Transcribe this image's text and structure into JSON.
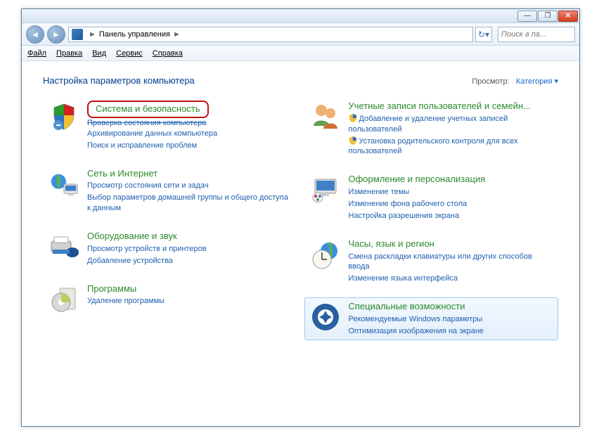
{
  "window": {
    "min": "—",
    "max": "❐",
    "close": "✕"
  },
  "nav": {
    "back": "◄",
    "fwd": "►",
    "crumb": "Панель управления",
    "arrow": "►",
    "refresh": "↻▾"
  },
  "search": {
    "placeholder": "Поиск в па..."
  },
  "menu": {
    "file": "Файл",
    "edit": "Правка",
    "view": "Вид",
    "tools": "Сервис",
    "help": "Справка"
  },
  "heading": "Настройка параметров компьютера",
  "view_label": "Просмотр:",
  "view_value": "Категория ▾",
  "left": [
    {
      "title": "Система и безопасность",
      "highlighted": true,
      "strike": "Проверка состояния компьютера",
      "subs": [
        "Архивирование данных компьютера",
        "Поиск и исправление проблем"
      ]
    },
    {
      "title": "Сеть и Интернет",
      "subs": [
        "Просмотр состояния сети и задач",
        "Выбор параметров домашней группы и общего доступа к данным"
      ]
    },
    {
      "title": "Оборудование и звук",
      "subs": [
        "Просмотр устройств и принтеров",
        "Добавление устройства"
      ]
    },
    {
      "title": "Программы",
      "subs": [
        "Удаление программы"
      ]
    }
  ],
  "right": [
    {
      "title": "Учетные записи пользователей и семейн...",
      "shield_subs": [
        "Добавление и удаление учетных записей пользователей",
        "Установка родительского контроля для всех пользователей"
      ]
    },
    {
      "title": "Оформление и персонализация",
      "subs": [
        "Изменение темы",
        "Изменение фона рабочего стола",
        "Настройка разрешения экрана"
      ]
    },
    {
      "title": "Часы, язык и регион",
      "subs": [
        "Смена раскладки клавиатуры или других способов ввода",
        "Изменение языка интерфейса"
      ]
    },
    {
      "title": "Специальные возможности",
      "selected": true,
      "subs": [
        "Рекомендуемые Windows параметры",
        "Оптимизация изображения на экране"
      ]
    }
  ]
}
